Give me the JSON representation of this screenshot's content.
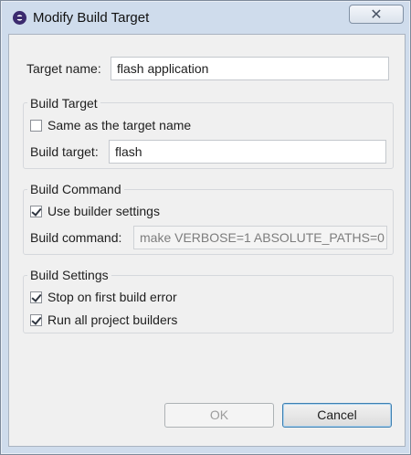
{
  "window": {
    "title": "Modify Build Target",
    "close_glyph": "✕"
  },
  "target_name": {
    "label": "Target name:",
    "value": "flash application"
  },
  "build_target": {
    "group_title": "Build Target",
    "same_as_name_label": "Same as the target name",
    "same_as_name_checked": false,
    "label": "Build target:",
    "value": "flash"
  },
  "build_command": {
    "group_title": "Build Command",
    "use_builder_label": "Use builder settings",
    "use_builder_checked": true,
    "label": "Build command:",
    "value": "make VERBOSE=1 ABSOLUTE_PATHS=0"
  },
  "build_settings": {
    "group_title": "Build Settings",
    "stop_on_error_label": "Stop on first build error",
    "stop_on_error_checked": true,
    "run_all_label": "Run all project builders",
    "run_all_checked": true
  },
  "buttons": {
    "ok_label": "OK",
    "cancel_label": "Cancel"
  }
}
